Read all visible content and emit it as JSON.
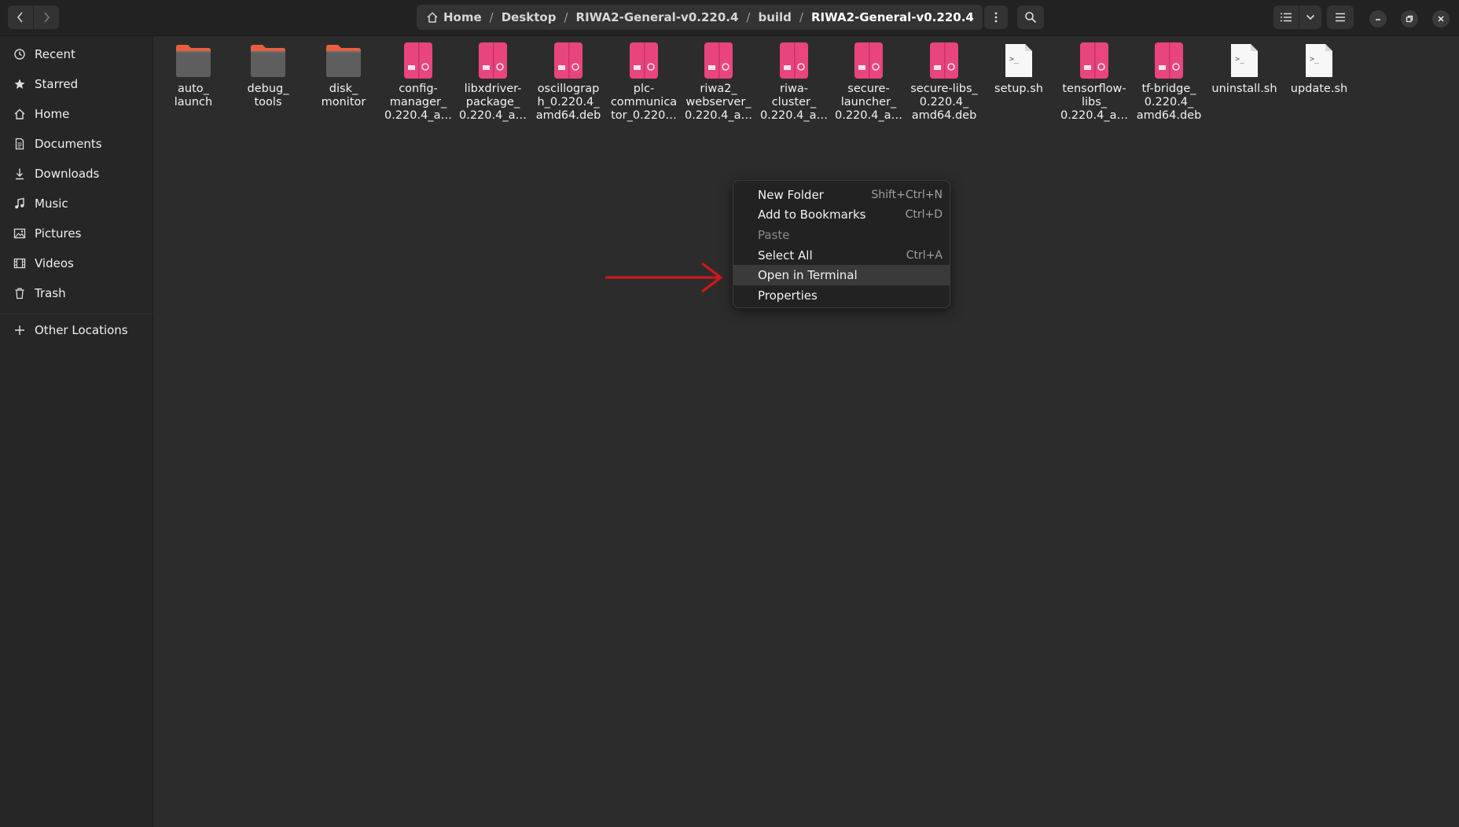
{
  "header": {
    "breadcrumbs": [
      "Home",
      "Desktop",
      "RIWA2-General-v0.220.4",
      "build",
      "RIWA2-General-v0.220.4"
    ]
  },
  "sidebar": {
    "items": [
      {
        "label": "Recent",
        "icon": "clock-icon"
      },
      {
        "label": "Starred",
        "icon": "star-icon"
      },
      {
        "label": "Home",
        "icon": "home-icon"
      },
      {
        "label": "Documents",
        "icon": "document-icon"
      },
      {
        "label": "Downloads",
        "icon": "download-icon"
      },
      {
        "label": "Music",
        "icon": "music-icon"
      },
      {
        "label": "Pictures",
        "icon": "picture-icon"
      },
      {
        "label": "Videos",
        "icon": "video-icon"
      },
      {
        "label": "Trash",
        "icon": "trash-icon"
      },
      {
        "label": "Other Locations",
        "icon": "plus-icon"
      }
    ]
  },
  "files": [
    {
      "name": "auto_\nlaunch",
      "type": "folder"
    },
    {
      "name": "debug_\ntools",
      "type": "folder"
    },
    {
      "name": "disk_\nmonitor",
      "type": "folder"
    },
    {
      "name": "config-\nmanager_\n0.220.4_a…",
      "type": "deb"
    },
    {
      "name": "libxdriver-\npackage_\n0.220.4_a…",
      "type": "deb"
    },
    {
      "name": "oscillograp\nh_0.220.4_\namd64.deb",
      "type": "deb"
    },
    {
      "name": "plc-\ncommunica\ntor_0.220…",
      "type": "deb"
    },
    {
      "name": "riwa2_\nwebserver_\n0.220.4_a…",
      "type": "deb"
    },
    {
      "name": "riwa-\ncluster_\n0.220.4_a…",
      "type": "deb"
    },
    {
      "name": "secure-\nlauncher_\n0.220.4_a…",
      "type": "deb"
    },
    {
      "name": "secure-libs_\n0.220.4_\namd64.deb",
      "type": "deb"
    },
    {
      "name": "setup.sh",
      "type": "script"
    },
    {
      "name": "tensorflow-\nlibs_\n0.220.4_a…",
      "type": "deb"
    },
    {
      "name": "tf-bridge_\n0.220.4_\namd64.deb",
      "type": "deb"
    },
    {
      "name": "uninstall.sh",
      "type": "script"
    },
    {
      "name": "update.sh",
      "type": "script"
    }
  ],
  "context_menu": {
    "items": [
      {
        "label": "New Folder",
        "accel": "Shift+Ctrl+N",
        "enabled": true
      },
      {
        "label": "Add to Bookmarks",
        "accel": "Ctrl+D",
        "enabled": true
      },
      {
        "label": "Paste",
        "accel": "",
        "enabled": false
      },
      {
        "label": "Select All",
        "accel": "Ctrl+A",
        "enabled": true
      },
      {
        "label": "Open in Terminal",
        "accel": "",
        "enabled": true,
        "highlighted": true
      },
      {
        "label": "Properties",
        "accel": "",
        "enabled": true
      }
    ]
  },
  "colors": {
    "deb_package": "#e8457e",
    "folder_body": "#5e5e5e",
    "folder_tab": "#e95e3f",
    "arrow": "#d01818"
  }
}
